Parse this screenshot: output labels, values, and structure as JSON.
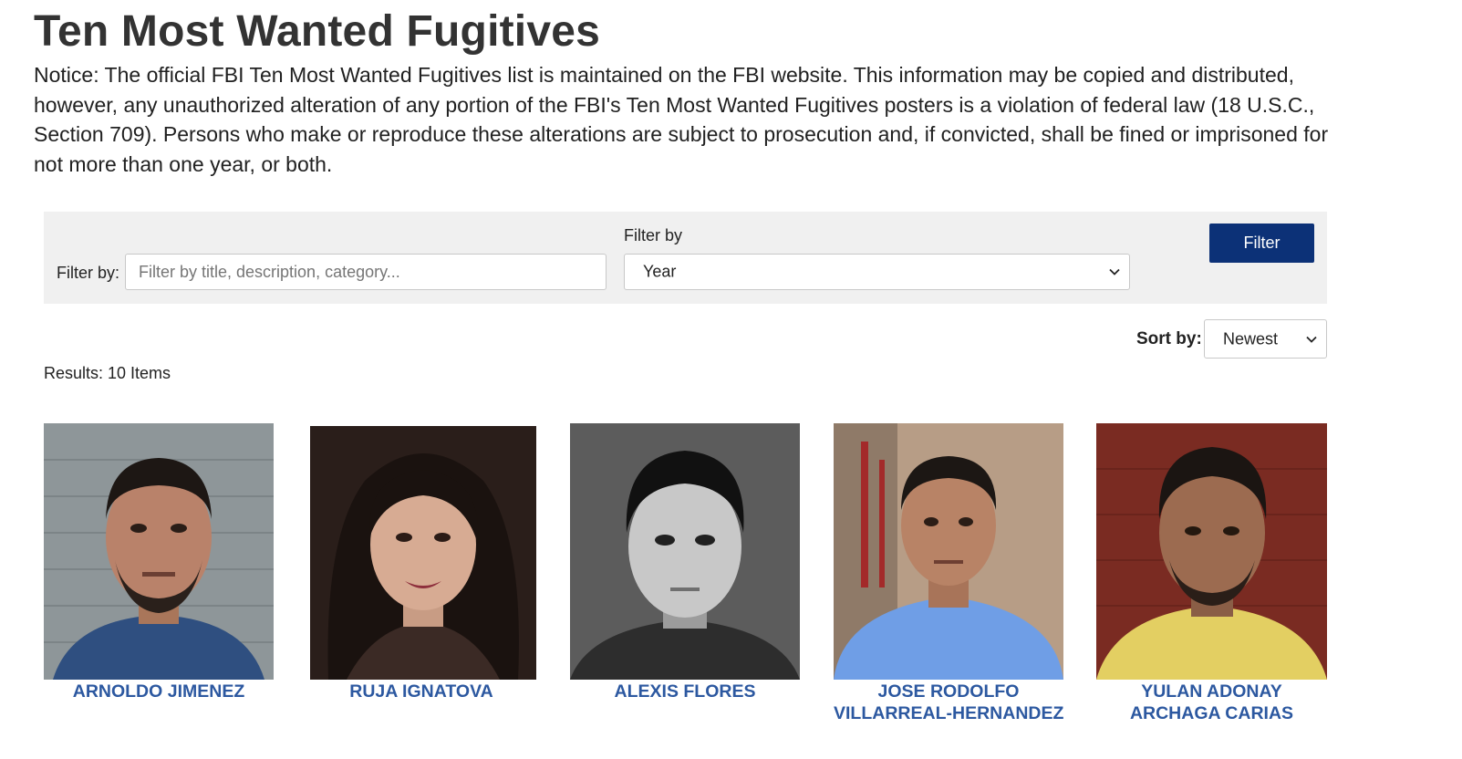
{
  "page": {
    "title": "Ten Most Wanted Fugitives",
    "notice": "Notice: The official FBI Ten Most Wanted Fugitives list is maintained on the FBI website. This information may be copied and distributed, however, any unauthorized alteration of any portion of the FBI's Ten Most Wanted Fugitives posters is a violation of federal law (18 U.S.C., Section 709). Persons who make or reproduce these alterations are subject to prosecution and, if convicted, shall be fined or imprisoned for not more than one year, or both."
  },
  "filters": {
    "text_label": "Filter by:",
    "text_placeholder": "Filter by title, description, category...",
    "year_label": "Filter by",
    "year_value": "Year",
    "button_label": "Filter"
  },
  "sort": {
    "label": "Sort by:",
    "value": "Newest"
  },
  "results": {
    "text": "Results: 10 Items"
  },
  "fugitives": [
    {
      "name_lines": [
        "ARNOLDO JIMENEZ"
      ]
    },
    {
      "name_lines": [
        "RUJA IGNATOVA"
      ]
    },
    {
      "name_lines": [
        "ALEXIS FLORES"
      ]
    },
    {
      "name_lines": [
        "JOSE RODOLFO",
        "VILLARREAL-HERNANDEZ"
      ]
    },
    {
      "name_lines": [
        "YULAN ADONAY",
        "ARCHAGA CARIAS"
      ]
    }
  ],
  "colors": {
    "link": "#2c58a0",
    "filter_button": "#0c3177",
    "filter_bar_bg": "#f0f0f0",
    "title_text": "#333333"
  }
}
